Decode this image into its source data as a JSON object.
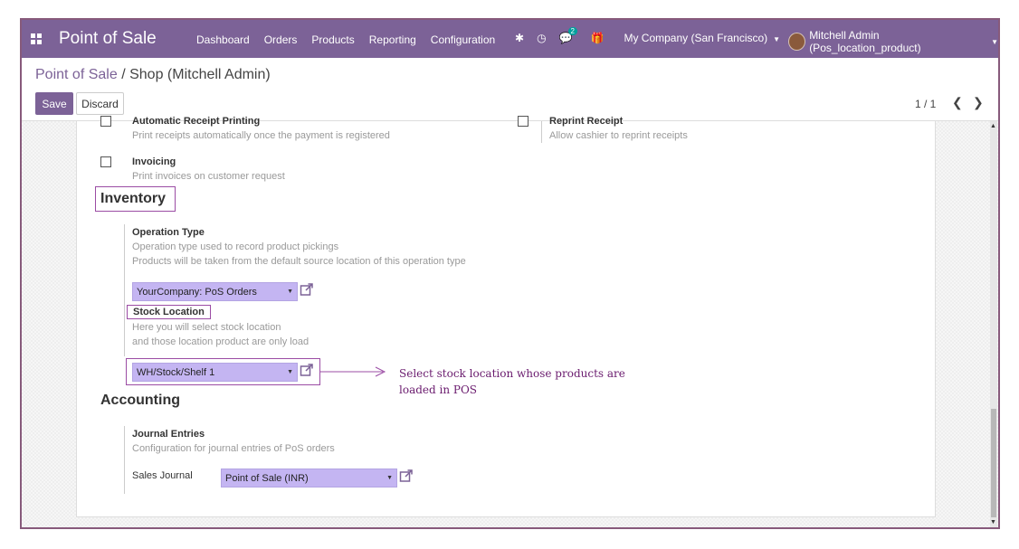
{
  "navbar": {
    "app_title": "Point of Sale",
    "menu": [
      "Dashboard",
      "Orders",
      "Products",
      "Reporting",
      "Configuration"
    ],
    "messages_count": "2",
    "company": "My Company (San Francisco)",
    "user": "Mitchell Admin (Pos_location_product)"
  },
  "breadcrumb": {
    "parent": "Point of Sale",
    "separator": "/",
    "current": "Shop (Mitchell Admin)"
  },
  "toolbar": {
    "save_label": "Save",
    "discard_label": "Discard"
  },
  "pager": {
    "value": "1 / 1"
  },
  "settings": {
    "receipt_printing": {
      "label": "Automatic Receipt Printing",
      "help": "Print receipts automatically once the payment is registered"
    },
    "reprint_receipt": {
      "label": "Reprint Receipt",
      "help": "Allow cashier to reprint receipts"
    },
    "invoicing": {
      "label": "Invoicing",
      "help": "Print invoices on customer request"
    },
    "inventory": {
      "title": "Inventory",
      "operation_type": {
        "label": "Operation Type",
        "help1": "Operation type used to record product pickings",
        "help2": "Products will be taken from the default source location of this operation type",
        "value": "YourCompany: PoS Orders"
      },
      "stock_location": {
        "label": "Stock Location",
        "help1": "Here you will select stock location",
        "help2": "and those location product are only load",
        "value": "WH/Stock/Shelf 1"
      }
    },
    "accounting": {
      "title": "Accounting",
      "journal_entries": {
        "label": "Journal Entries",
        "help": "Configuration for journal entries of PoS orders"
      },
      "sales_journal": {
        "label": "Sales Journal",
        "value": "Point of Sale (INR)"
      }
    }
  },
  "annotation": {
    "line1": "Select stock location whose products are",
    "line2": "loaded in POS"
  },
  "colors": {
    "brand": "#7C6297",
    "select_bg": "#C4B5F2",
    "highlight": "#9b4ca4",
    "annotation": "#6a1b6e"
  }
}
